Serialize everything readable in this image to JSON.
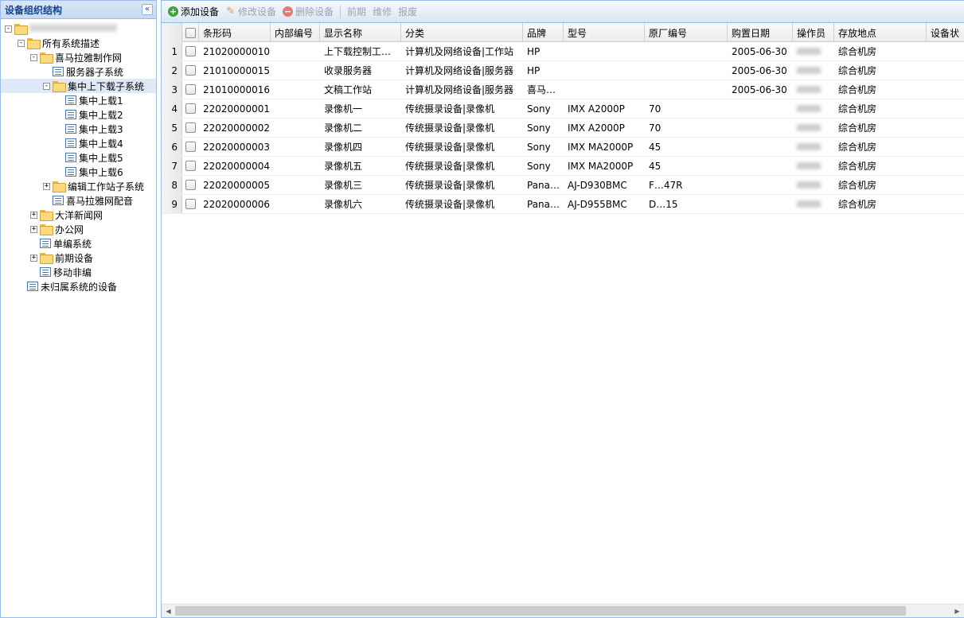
{
  "sidebar": {
    "title": "设备组织结构",
    "collapse_glyph": "«",
    "tree": [
      {
        "label": "",
        "depth": 0,
        "expander": "-",
        "icon": "folder",
        "blurred": true
      },
      {
        "label": "所有系统描述",
        "depth": 1,
        "expander": "-",
        "icon": "folder"
      },
      {
        "label": "喜马拉雅制作网",
        "depth": 2,
        "expander": "-",
        "icon": "folder"
      },
      {
        "label": "服务器子系统",
        "depth": 3,
        "expander": "",
        "icon": "node"
      },
      {
        "label": "集中上下载子系统",
        "depth": 3,
        "expander": "-",
        "icon": "folder",
        "selected": true
      },
      {
        "label": "集中上载1",
        "depth": 4,
        "expander": "",
        "icon": "node"
      },
      {
        "label": "集中上载2",
        "depth": 4,
        "expander": "",
        "icon": "node"
      },
      {
        "label": "集中上载3",
        "depth": 4,
        "expander": "",
        "icon": "node"
      },
      {
        "label": "集中上载4",
        "depth": 4,
        "expander": "",
        "icon": "node"
      },
      {
        "label": "集中上载5",
        "depth": 4,
        "expander": "",
        "icon": "node"
      },
      {
        "label": "集中上载6",
        "depth": 4,
        "expander": "",
        "icon": "node"
      },
      {
        "label": "编辑工作站子系统",
        "depth": 3,
        "expander": "+",
        "icon": "folder"
      },
      {
        "label": "喜马拉雅网配音",
        "depth": 3,
        "expander": "",
        "icon": "node"
      },
      {
        "label": "大洋新闻网",
        "depth": 2,
        "expander": "+",
        "icon": "folder"
      },
      {
        "label": "办公网",
        "depth": 2,
        "expander": "+",
        "icon": "folder"
      },
      {
        "label": "单编系统",
        "depth": 2,
        "expander": "",
        "icon": "node"
      },
      {
        "label": "前期设备",
        "depth": 2,
        "expander": "+",
        "icon": "folder"
      },
      {
        "label": "移动非编",
        "depth": 2,
        "expander": "",
        "icon": "node"
      },
      {
        "label": "未归属系统的设备",
        "depth": 1,
        "expander": "",
        "icon": "node"
      }
    ]
  },
  "toolbar": {
    "add_label": "添加设备",
    "edit_label": "修改设备",
    "delete_label": "删除设备",
    "preliminary_label": "前期",
    "repair_label": "维修",
    "scrap_label": "报废"
  },
  "grid": {
    "columns": [
      {
        "key": "barcode",
        "label": "条形码"
      },
      {
        "key": "internal_no",
        "label": "内部编号"
      },
      {
        "key": "display_name",
        "label": "显示名称"
      },
      {
        "key": "category",
        "label": "分类"
      },
      {
        "key": "brand",
        "label": "品牌"
      },
      {
        "key": "model",
        "label": "型号"
      },
      {
        "key": "factory_no",
        "label": "原厂编号"
      },
      {
        "key": "purchase_date",
        "label": "购置日期"
      },
      {
        "key": "operator",
        "label": "操作员"
      },
      {
        "key": "location",
        "label": "存放地点"
      },
      {
        "key": "status",
        "label": "设备状"
      }
    ],
    "rows": [
      {
        "num": "1",
        "barcode": "21020000010",
        "internal_no": "",
        "display_name": "上下载控制工…",
        "category": "计算机及网络设备|工作站",
        "brand": "HP",
        "model": "",
        "factory_no": "",
        "purchase_date": "2005-06-30",
        "operator_blur": true,
        "location": "综合机房",
        "status": ""
      },
      {
        "num": "2",
        "barcode": "21010000015",
        "internal_no": "",
        "display_name": "收录服务器",
        "category": "计算机及网络设备|服务器",
        "brand": "HP",
        "model": "",
        "factory_no": "",
        "purchase_date": "2005-06-30",
        "operator_blur": true,
        "location": "综合机房",
        "status": ""
      },
      {
        "num": "3",
        "barcode": "21010000016",
        "internal_no": "",
        "display_name": "文稿工作站",
        "category": "计算机及网络设备|服务器",
        "brand": "喜马…",
        "model": "",
        "factory_no": "",
        "purchase_date": "2005-06-30",
        "operator_blur": true,
        "location": "综合机房",
        "status": ""
      },
      {
        "num": "4",
        "barcode": "22020000001",
        "internal_no": "",
        "display_name": "录像机一",
        "category": "传统摄录设备|录像机",
        "brand": "Sony",
        "model": "IMX A2000P",
        "factory_no": "70",
        "purchase_date": "",
        "operator_blur": true,
        "location": "综合机房",
        "status": ""
      },
      {
        "num": "5",
        "barcode": "22020000002",
        "internal_no": "",
        "display_name": "录像机二",
        "category": "传统摄录设备|录像机",
        "brand": "Sony",
        "model": "IMX A2000P",
        "factory_no": "70",
        "purchase_date": "",
        "operator_blur": true,
        "location": "综合机房",
        "status": ""
      },
      {
        "num": "6",
        "barcode": "22020000003",
        "internal_no": "",
        "display_name": "录像机四",
        "category": "传统摄录设备|录像机",
        "brand": "Sony",
        "model": "IMX MA2000P",
        "factory_no": "45",
        "purchase_date": "",
        "operator_blur": true,
        "location": "综合机房",
        "status": ""
      },
      {
        "num": "7",
        "barcode": "22020000004",
        "internal_no": "",
        "display_name": "录像机五",
        "category": "传统摄录设备|录像机",
        "brand": "Sony",
        "model": "IMX MA2000P",
        "factory_no": "45",
        "purchase_date": "",
        "operator_blur": true,
        "location": "综合机房",
        "status": ""
      },
      {
        "num": "8",
        "barcode": "22020000005",
        "internal_no": "",
        "display_name": "录像机三",
        "category": "传统摄录设备|录像机",
        "brand": "Pana…",
        "model": "AJ-D930BMC",
        "factory_no": "F…47R",
        "purchase_date": "",
        "operator_blur": true,
        "location": "综合机房",
        "status": ""
      },
      {
        "num": "9",
        "barcode": "22020000006",
        "internal_no": "",
        "display_name": "录像机六",
        "category": "传统摄录设备|录像机",
        "brand": "Pana…",
        "model": "AJ-D955BMC",
        "factory_no": "D…15",
        "purchase_date": "",
        "operator_blur": true,
        "location": "综合机房",
        "status": ""
      }
    ]
  },
  "scrollbar": {
    "left_glyph": "◀",
    "right_glyph": "▶"
  }
}
